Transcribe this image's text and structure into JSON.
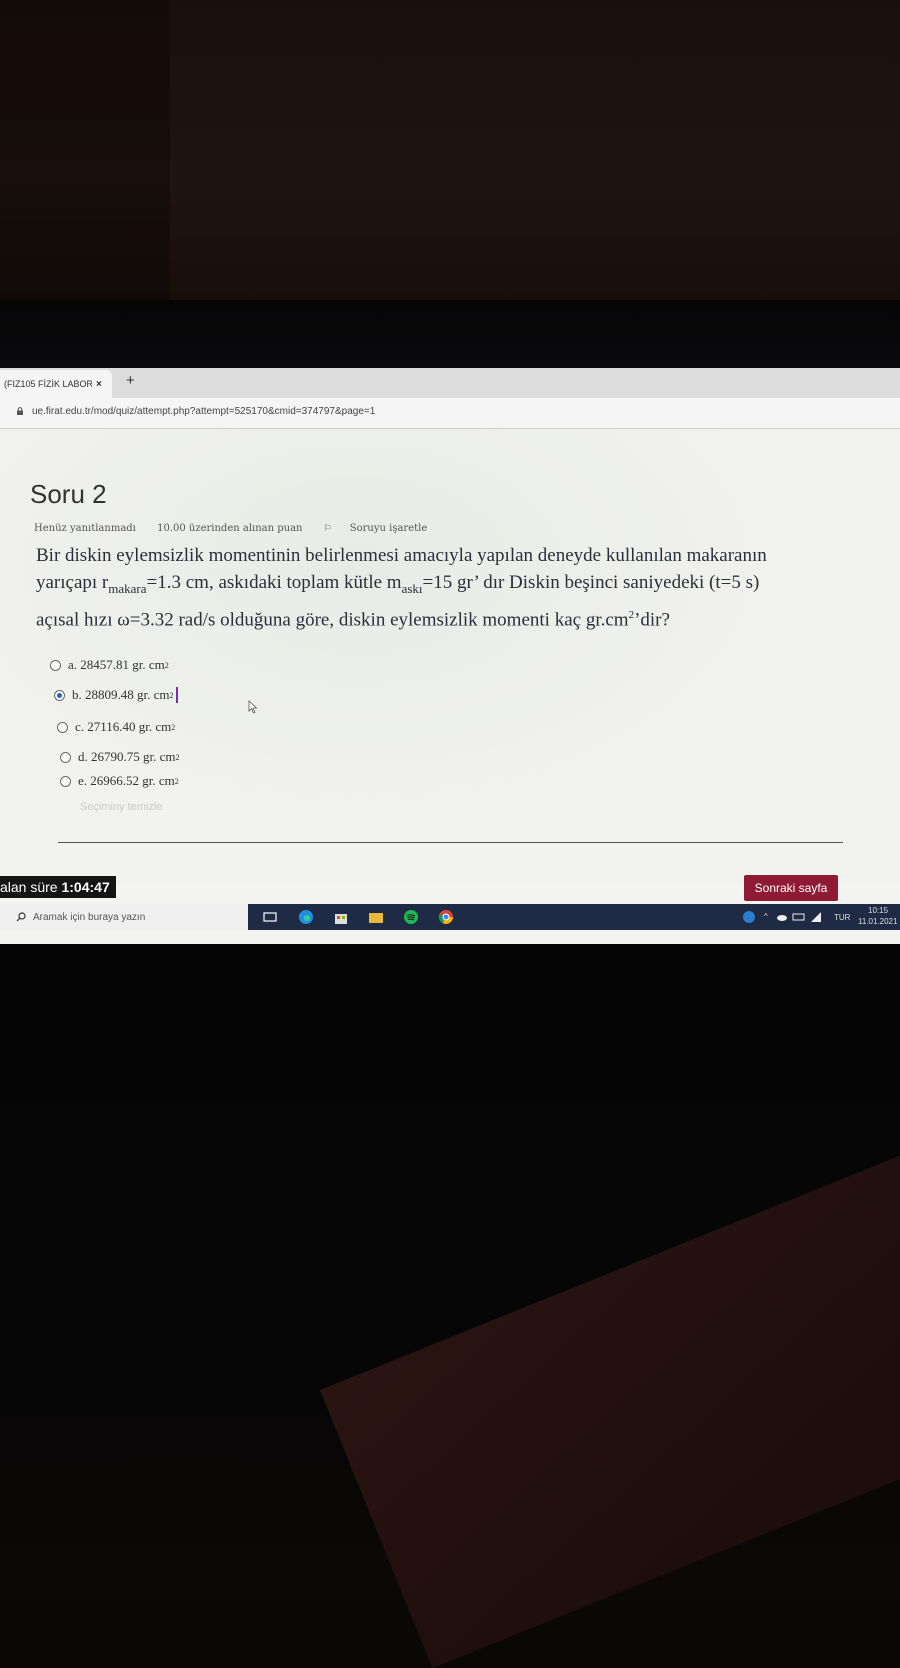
{
  "browser": {
    "tab_title": "(FIZ105 FİZİK LABOR",
    "tab_close": "×",
    "new_tab": "+",
    "url": "ue.firat.edu.tr/mod/quiz/attempt.php?attempt=525170&cmid=374797&page=1"
  },
  "question": {
    "title": "Soru 2",
    "status": "Henüz yanıtlanmadı",
    "points": "10.00 üzerinden alınan puan",
    "flag_label": "Soruyu işaretle",
    "text_line1": "Bir diskin eylemsizlik momentinin belirlenmesi amacıyla yapılan deneyde kullanılan makaranın",
    "text_line2_pre": "yarıçapı r",
    "text_line2_sub1": "makara",
    "text_line2_mid": "=1.3 cm, askıdaki toplam kütle m",
    "text_line2_sub2": "askı",
    "text_line2_post": "=15 gr’ dır Diskin beşinci saniyedeki (t=5 s)",
    "text_line3_pre": "açısal hızı ω=3.32 rad/s olduğuna göre, diskin eylemsizlik momenti kaç gr.cm",
    "text_line3_sup": "2",
    "text_line3_post": "’dir?"
  },
  "options": [
    {
      "label": "a. 28457.81 gr. cm",
      "sup": "2",
      "selected": false
    },
    {
      "label": "b. 28809.48 gr. cm",
      "sup": "2",
      "selected": true
    },
    {
      "label": "c. 27116.40 gr. cm",
      "sup": "2",
      "selected": false
    },
    {
      "label": "d. 26790.75 gr. cm",
      "sup": "2",
      "selected": false
    },
    {
      "label": "e. 26966.52 gr. cm",
      "sup": "2",
      "selected": false
    }
  ],
  "clear_choice": "Seçiminy temizle",
  "timer": {
    "label": "alan süre",
    "value": "1:04:47"
  },
  "next_button": "Sonraki sayfa",
  "taskbar": {
    "search_placeholder": "Aramak için buraya yazın",
    "lang": "TUR",
    "time": "10:15",
    "date": "11.01.2021"
  },
  "colors": {
    "next_button": "#8e1b33",
    "selected_radio": "#1a64d6",
    "taskbar": "#1f2a44"
  }
}
